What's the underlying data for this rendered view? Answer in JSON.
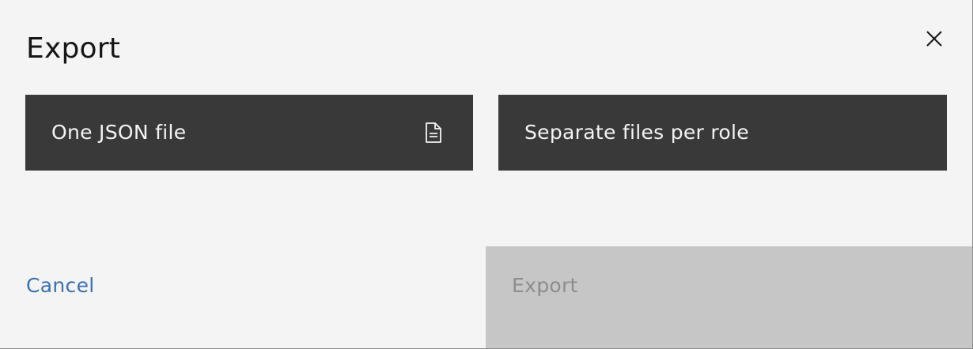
{
  "dialog": {
    "title": "Export",
    "close_icon": "close-icon"
  },
  "options": [
    {
      "label": "One JSON file",
      "icon": "document-icon",
      "selected": true
    },
    {
      "label": "Separate files per role",
      "selected": false
    }
  ],
  "footer": {
    "cancel_label": "Cancel",
    "export_label": "Export",
    "export_disabled": true
  },
  "colors": {
    "background": "#f4f4f4",
    "tile": "#393939",
    "tile_text": "#f4f4f4",
    "link": "#3d70b2",
    "disabled_bg": "#c6c6c6",
    "disabled_text": "#8d8d8d"
  }
}
